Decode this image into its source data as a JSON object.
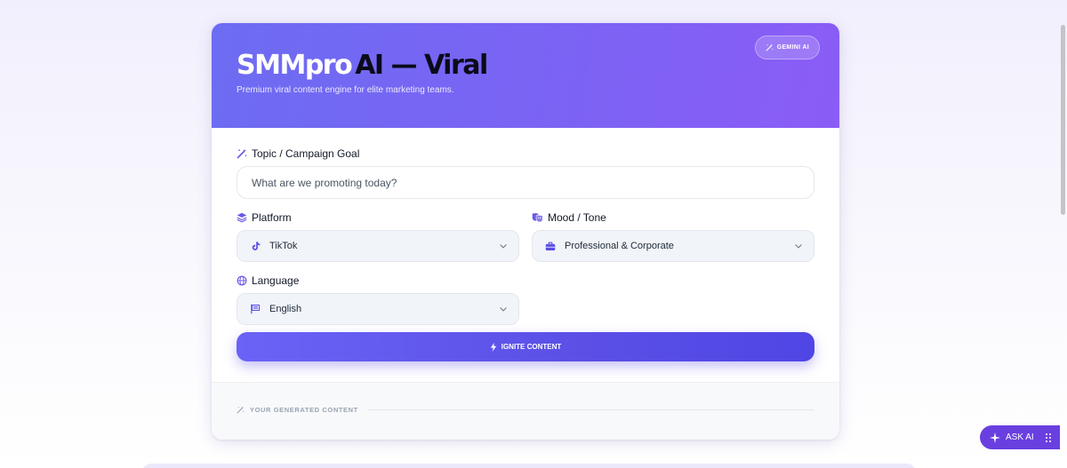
{
  "header": {
    "title_part1": "SMM",
    "title_part2": "pro",
    "title_part3": "AI — Viral",
    "subtitle": "Premium viral content engine for elite marketing teams.",
    "badge": "GEMINI AI"
  },
  "topic": {
    "label": "Topic / Campaign Goal",
    "placeholder": "What are we promoting today?",
    "value": ""
  },
  "platform": {
    "label": "Platform",
    "selected": "TikTok",
    "icon": "tiktok-icon"
  },
  "mood": {
    "label": "Mood / Tone",
    "selected": "Professional & Corporate",
    "icon": "briefcase-icon"
  },
  "language": {
    "label": "Language",
    "selected": "English",
    "icon": "flag-icon"
  },
  "ignite_button": {
    "label": "IGNITE CONTENT"
  },
  "results": {
    "label": "YOUR GENERATED CONTENT"
  },
  "ask_ai": {
    "label": "ASK AI"
  },
  "colors": {
    "accent": "#5b4fe6",
    "header_start": "#6d6cf2",
    "header_end": "#8b5cf6",
    "ask_ai_bg": "#6a3fe0"
  }
}
